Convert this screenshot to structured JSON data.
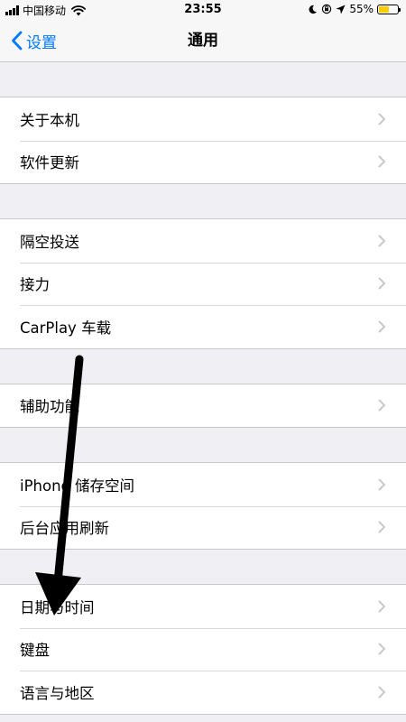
{
  "status_bar": {
    "carrier": "中国移动",
    "time": "23:55",
    "battery_percent": "55%",
    "battery_level": 0.55,
    "icons": [
      "signal-icon",
      "wifi-icon",
      "moon-icon",
      "orientation-lock-icon",
      "location-icon",
      "battery-icon"
    ]
  },
  "nav": {
    "back_label": "设置",
    "title": "通用"
  },
  "groups": [
    {
      "items": [
        {
          "label": "关于本机"
        },
        {
          "label": "软件更新"
        }
      ]
    },
    {
      "items": [
        {
          "label": "隔空投送"
        },
        {
          "label": "接力"
        },
        {
          "label": "CarPlay 车载"
        }
      ]
    },
    {
      "items": [
        {
          "label": "辅助功能"
        }
      ]
    },
    {
      "items": [
        {
          "label": "iPhone 储存空间"
        },
        {
          "label": "后台应用刷新"
        }
      ]
    },
    {
      "items": [
        {
          "label": "日期与时间"
        },
        {
          "label": "键盘"
        },
        {
          "label": "语言与地区"
        }
      ]
    }
  ],
  "colors": {
    "accent": "#007aff",
    "background": "#efeff4",
    "battery": "#ffcc00",
    "chevron": "#c7c7cc",
    "annotation_arrow": "#000000"
  }
}
